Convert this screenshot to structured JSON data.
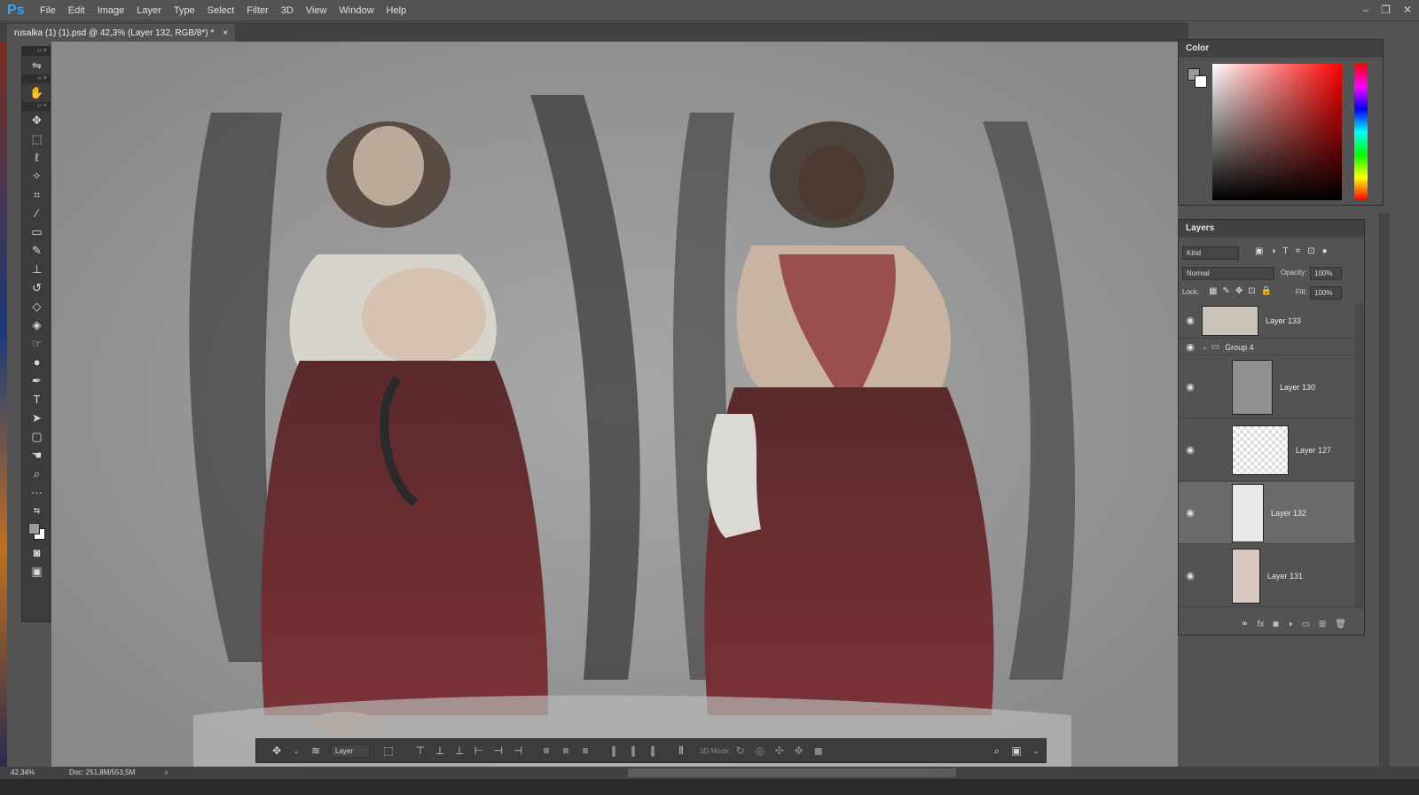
{
  "app": {
    "logo": "Ps"
  },
  "menu": [
    "File",
    "Edit",
    "Image",
    "Layer",
    "Type",
    "Select",
    "Filter",
    "3D",
    "View",
    "Window",
    "Help"
  ],
  "window_controls": {
    "minimize": "–",
    "restore": "❐",
    "close": "✕"
  },
  "document_tab": {
    "title": "rusalka (1) (1).psd @ 42,3% (Layer 132, RGB/8*) *",
    "close": "×"
  },
  "color_panel": {
    "title": "Color"
  },
  "layers_panel": {
    "title": "Layers",
    "filter_kind": "Kind",
    "blend_mode": "Normal",
    "opacity_label": "Opacity:",
    "opacity_value": "100%",
    "lock_label": "Lock:",
    "fill_label": "Fill:",
    "fill_value": "100%",
    "layers": [
      {
        "name": "Layer 133"
      },
      {
        "name": "Group 4"
      },
      {
        "name": "Layer 130"
      },
      {
        "name": "Layer 127"
      },
      {
        "name": "Layer 132",
        "selected": true
      },
      {
        "name": "Layer 131"
      }
    ]
  },
  "options_bar": {
    "auto_select_target": "Layer",
    "mode_3d": "3D Mode:"
  },
  "status": {
    "zoom": "42,34%",
    "doc": "Doc: 251,8M/553,5M"
  },
  "colors": {
    "accent": "#31a8ff",
    "panel_bg": "#535353",
    "dark_bg": "#424242",
    "canvas_bg": "#8a8a8a"
  },
  "icons": [
    "move-icon",
    "marquee-icon",
    "lasso-icon",
    "magic-wand-icon",
    "crop-icon",
    "eyedropper-icon",
    "healing-brush-icon",
    "brush-icon",
    "clone-stamp-icon",
    "history-brush-icon",
    "eraser-icon",
    "paint-bucket-icon",
    "smudge-icon",
    "dodge-icon",
    "pen-icon",
    "type-icon",
    "path-select-icon",
    "rectangle-icon",
    "hand-icon",
    "zoom-icon",
    "more-icon"
  ]
}
